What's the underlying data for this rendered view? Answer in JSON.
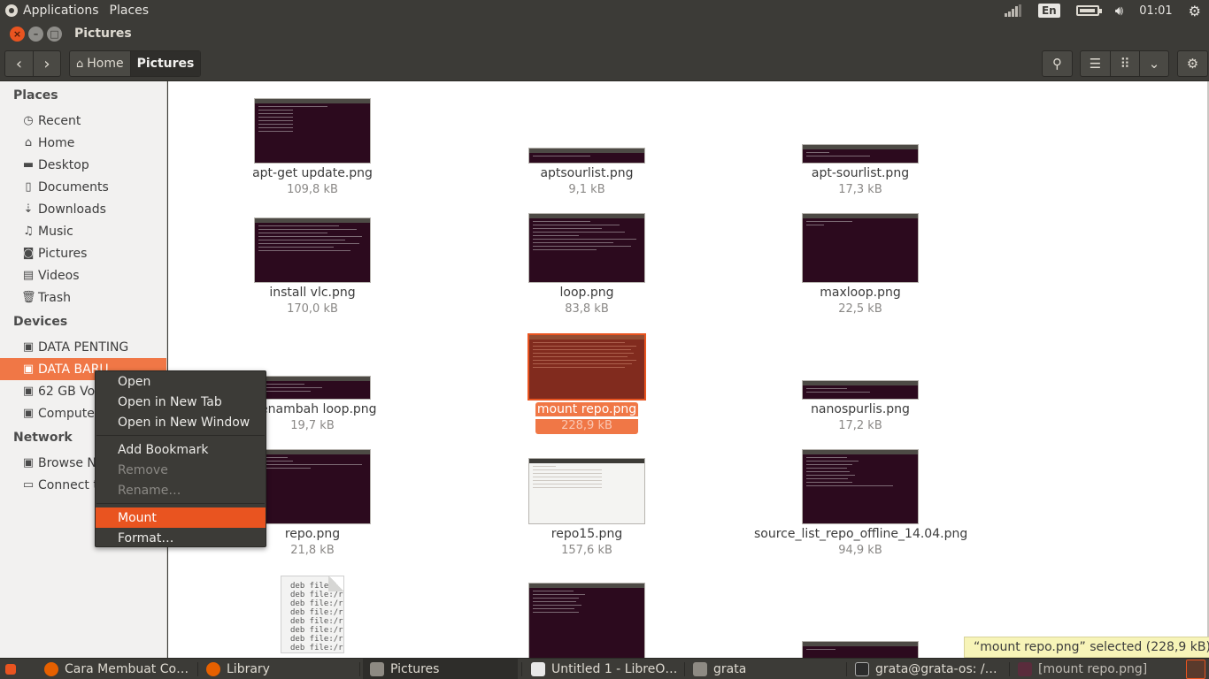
{
  "top_panel": {
    "menus": [
      "Applications",
      "Places"
    ],
    "lang": "En",
    "clock": "01:01",
    "icons": [
      "apps-icon",
      "wifi-icon",
      "battery-icon",
      "volume-icon",
      "gear-icon"
    ]
  },
  "window": {
    "title": "Pictures",
    "controls": [
      "close-icon",
      "minimize-icon",
      "maximize-icon"
    ]
  },
  "toolbar": {
    "back": "‹",
    "forward": "›",
    "path": [
      "Home",
      "Pictures"
    ],
    "right_icons": [
      "search-icon",
      "list-view-icon",
      "grid-view-icon",
      "chevron-down-icon",
      "gear-icon"
    ]
  },
  "sidebar": {
    "places_label": "Places",
    "places": [
      {
        "label": "Recent",
        "icon": "clock-icon"
      },
      {
        "label": "Home",
        "icon": "home-icon"
      },
      {
        "label": "Desktop",
        "icon": "folder-icon"
      },
      {
        "label": "Documents",
        "icon": "document-icon"
      },
      {
        "label": "Downloads",
        "icon": "download-icon"
      },
      {
        "label": "Music",
        "icon": "music-icon"
      },
      {
        "label": "Pictures",
        "icon": "camera-icon"
      },
      {
        "label": "Videos",
        "icon": "film-icon"
      },
      {
        "label": "Trash",
        "icon": "trash-icon"
      }
    ],
    "devices_label": "Devices",
    "devices": [
      {
        "label": "DATA PENTING",
        "icon": "drive-icon"
      },
      {
        "label": "DATA BARU",
        "icon": "drive-icon"
      },
      {
        "label": "62 GB Volume",
        "icon": "drive-icon"
      },
      {
        "label": "Computer",
        "icon": "drive-icon"
      }
    ],
    "network_label": "Network",
    "network": [
      {
        "label": "Browse Network",
        "icon": "network-icon"
      },
      {
        "label": "Connect to Server",
        "icon": "server-icon"
      }
    ]
  },
  "files": [
    {
      "name": "apt-get update.png",
      "size": "109,8 kB"
    },
    {
      "name": "aptsourlist.png",
      "size": "9,1 kB"
    },
    {
      "name": "apt-sourlist.png",
      "size": "17,3 kB"
    },
    {
      "name": "install vlc.png",
      "size": "170,0 kB"
    },
    {
      "name": "loop.png",
      "size": "83,8 kB"
    },
    {
      "name": "maxloop.png",
      "size": "22,5 kB"
    },
    {
      "name": "menambah loop.png",
      "size": "19,7 kB"
    },
    {
      "name": "mount repo.png",
      "size": "228,9 kB"
    },
    {
      "name": "nanospurlis.png",
      "size": "17,2 kB"
    },
    {
      "name": "repo.png",
      "size": "21,8 kB"
    },
    {
      "name": "repo15.png",
      "size": "157,6 kB"
    },
    {
      "name": "source_list_repo_offline_14.04.png",
      "size": "94,9 kB"
    }
  ],
  "text_doc_preview": "deb file:/r\ndeb file:/r\ndeb file:/r\ndeb file:/r\ndeb file:/r\ndeb file:/r\ndeb file:/r\ndeb file:/r",
  "status_text": "“mount repo.png” selected  (228,9 kB)",
  "context_menu": [
    {
      "label": "Open",
      "enabled": true
    },
    {
      "label": "Open in New Tab",
      "enabled": true
    },
    {
      "label": "Open in New Window",
      "enabled": true
    },
    {
      "label": "Add Bookmark",
      "enabled": true
    },
    {
      "label": "Remove",
      "enabled": false
    },
    {
      "label": "Rename…",
      "enabled": false
    },
    {
      "label": "Mount",
      "enabled": true
    },
    {
      "label": "Format…",
      "enabled": true
    }
  ],
  "taskbar": [
    {
      "label": "Cara Membuat Co…",
      "icon": "firefox-icon"
    },
    {
      "label": "Library",
      "icon": "firefox-icon"
    },
    {
      "label": "Pictures",
      "icon": "files-icon"
    },
    {
      "label": "Untitled 1 - LibreO…",
      "icon": "writer-icon"
    },
    {
      "label": "grata",
      "icon": "files-icon"
    },
    {
      "label": "grata@grata-os: /…",
      "icon": "terminal-icon"
    },
    {
      "label": "[mount repo.png]",
      "icon": "image-viewer-icon"
    }
  ],
  "colors": {
    "accent": "#e95420",
    "selection": "#f07746",
    "panel": "#3c3b37",
    "terminal": "#2c0a1e"
  }
}
